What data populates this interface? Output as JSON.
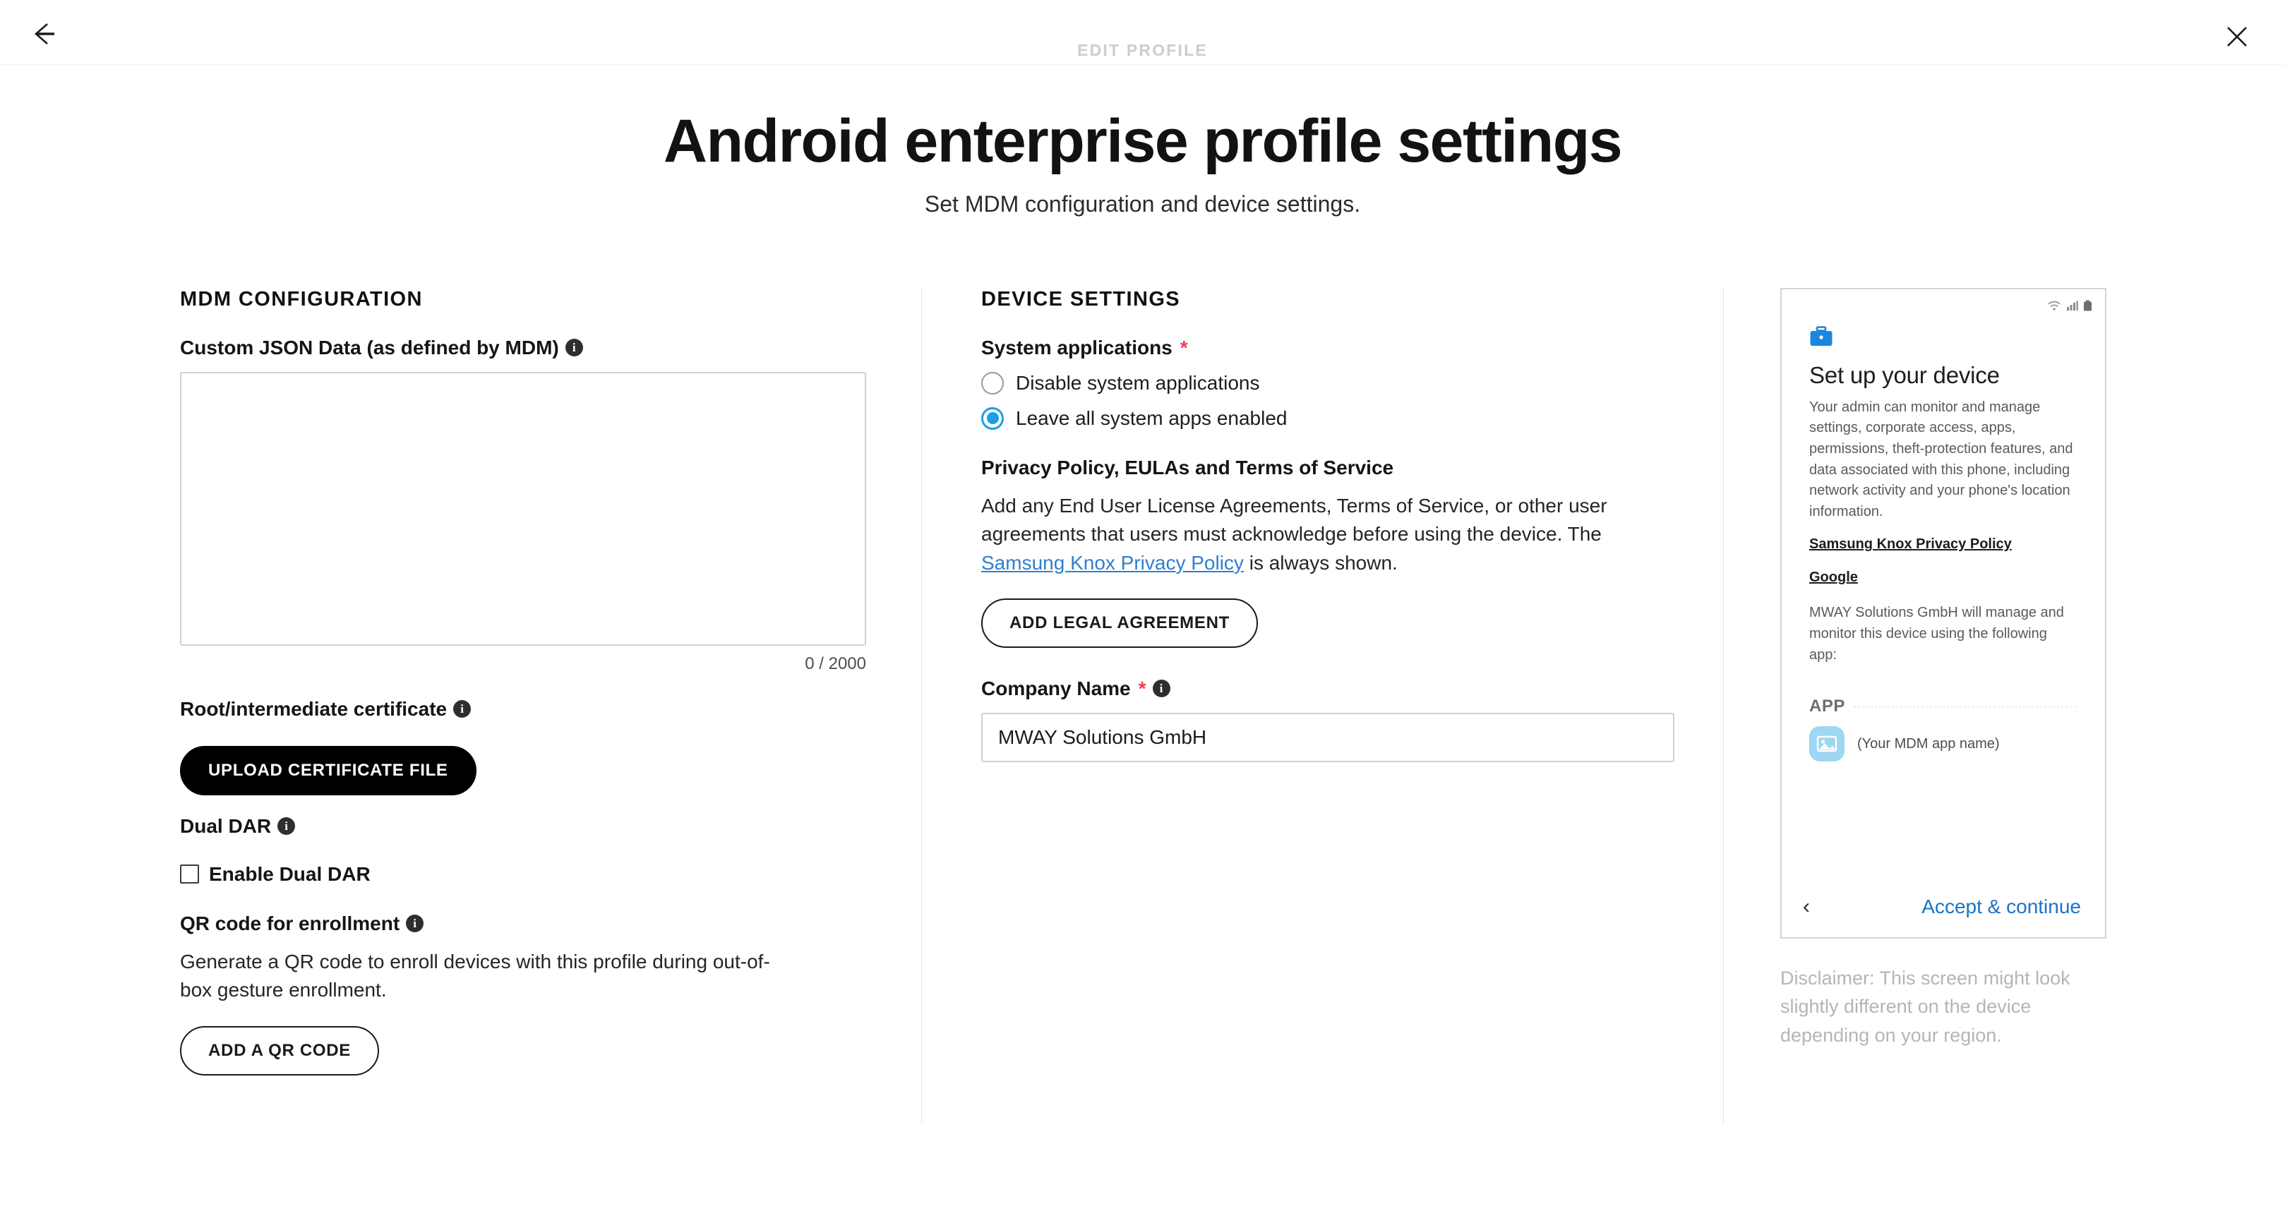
{
  "topbar": {
    "title": "EDIT PROFILE",
    "back_icon": "arrow-left-icon",
    "close_icon": "close-icon"
  },
  "hero": {
    "title": "Android enterprise profile settings",
    "subtitle": "Set MDM configuration and device settings."
  },
  "mdm": {
    "section_title": "MDM CONFIGURATION",
    "json_label": "Custom JSON Data (as defined by MDM)",
    "json_value": "",
    "json_placeholder": "",
    "counter": "0 / 2000",
    "cert_label": "Root/intermediate certificate",
    "upload_button": "UPLOAD CERTIFICATE FILE",
    "dual_dar_label": "Dual DAR",
    "dual_dar_checkbox": "Enable Dual DAR",
    "dual_dar_checked": false,
    "qr_label": "QR code for enrollment",
    "qr_description": "Generate a QR code to enroll devices with this profile during out-of-box gesture enrollment.",
    "qr_button": "ADD A QR CODE"
  },
  "device_settings": {
    "section_title": "DEVICE SETTINGS",
    "system_apps_label": "System applications",
    "system_apps_required": "*",
    "radios": [
      {
        "label": "Disable system applications",
        "checked": false
      },
      {
        "label": "Leave all system apps enabled",
        "checked": true
      }
    ],
    "privacy_heading": "Privacy Policy, EULAs and Terms of Service",
    "privacy_text_before": "Add any End User License Agreements, Terms of Service, or other user agreements that users must acknowledge before using the device. The ",
    "privacy_link": "Samsung Knox Privacy Policy",
    "privacy_text_after": " is always shown.",
    "legal_button": "ADD LEGAL AGREEMENT",
    "company_label": "Company Name",
    "company_required": "*",
    "company_value": "MWAY Solutions GmbH",
    "company_placeholder": "Company name"
  },
  "preview": {
    "status_icons": [
      "wifi-icon",
      "signal-icon",
      "battery-icon"
    ],
    "briefcase_icon": "briefcase-icon",
    "heading": "Set up your device",
    "body": "Your admin can monitor and manage settings, corporate access, apps, permissions, theft-protection features, and data associated with this phone, including network activity and your phone's location information.",
    "link_knox": "Samsung Knox Privacy Policy",
    "link_google": "Google",
    "manage_text": "MWAY Solutions GmbH will manage and monitor this device using the following app:",
    "app_section_label": "APP",
    "app_icon": "image-placeholder-icon",
    "app_name": "(Your MDM app name)",
    "back_chevron": "chevron-left-icon",
    "accept_label": "Accept & continue",
    "disclaimer": "Disclaimer: This screen might look slightly different on the device depending on your region."
  },
  "colors": {
    "accent_blue": "#1aa0e8",
    "link_blue": "#2f7fd1",
    "required_red": "#ef3e55",
    "device_blue": "#1a73c7",
    "briefcase_blue": "#1a86e0"
  }
}
